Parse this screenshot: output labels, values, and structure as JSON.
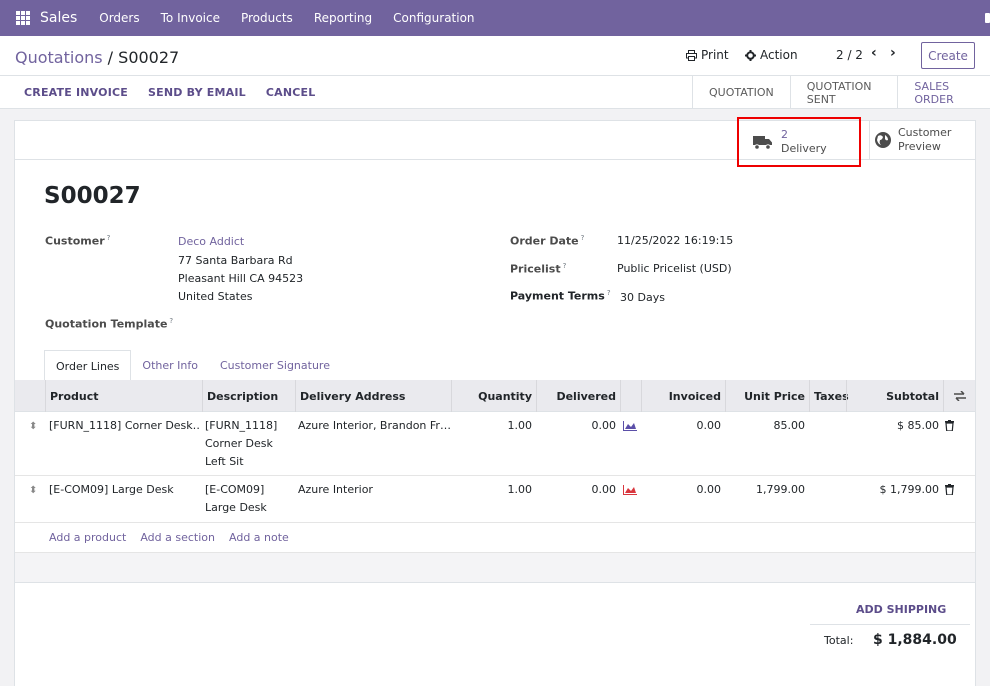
{
  "nav": {
    "brand": "Sales",
    "items": [
      "Orders",
      "To Invoice",
      "Products",
      "Reporting",
      "Configuration"
    ]
  },
  "control_panel": {
    "breadcrumb_parent": "Quotations",
    "breadcrumb_sep": " / ",
    "breadcrumb_current": "S00027",
    "print": "Print",
    "action": "Action",
    "pager": "2 / 2",
    "create": "Create"
  },
  "header": {
    "buttons": [
      "CREATE INVOICE",
      "SEND BY EMAIL",
      "CANCEL"
    ],
    "stages": [
      "QUOTATION",
      "QUOTATION SENT",
      "SALES ORDER"
    ],
    "active_stage": "SALES ORDER"
  },
  "smart_buttons": {
    "delivery_count": "2",
    "delivery_label": "Delivery",
    "preview_line1": "Customer",
    "preview_line2": "Preview"
  },
  "form": {
    "name": "S00027",
    "customer_label": "Customer",
    "customer_name": "Deco Addict",
    "address_line1": "77 Santa Barbara Rd",
    "address_line2": "Pleasant Hill CA 94523",
    "address_line3": "United States",
    "quotation_template_label": "Quotation Template",
    "order_date_label": "Order Date",
    "order_date": "11/25/2022 16:19:15",
    "pricelist_label": "Pricelist",
    "pricelist": "Public Pricelist (USD)",
    "payment_terms_label": "Payment Terms",
    "payment_terms": "30 Days",
    "help_mark": "?"
  },
  "tabs": [
    "Order Lines",
    "Other Info",
    "Customer Signature"
  ],
  "order_lines": {
    "columns": [
      "Product",
      "Description",
      "Delivery Address",
      "Quantity",
      "Delivered",
      "Invoiced",
      "Unit Price",
      "Taxes",
      "Subtotal"
    ],
    "rows": [
      {
        "product": "[FURN_1118] Corner Desk…",
        "description": [
          "[FURN_1118]",
          "Corner Desk",
          "Left Sit"
        ],
        "delivery_address": "Azure Interior, Brandon Fr…",
        "quantity": "1.00",
        "delivered": "0.00",
        "invoiced": "0.00",
        "unit_price": "85.00",
        "taxes": "",
        "subtotal": "$ 85.00",
        "forecast_color": "#5b4fa8"
      },
      {
        "product": "[E-COM09] Large Desk",
        "description": [
          "[E-COM09]",
          "Large Desk"
        ],
        "delivery_address": "Azure Interior",
        "quantity": "1.00",
        "delivered": "0.00",
        "invoiced": "0.00",
        "unit_price": "1,799.00",
        "taxes": "",
        "subtotal": "$ 1,799.00",
        "forecast_color": "#d9363e"
      }
    ],
    "add_product": "Add a product",
    "add_section": "Add a section",
    "add_note": "Add a note"
  },
  "totals": {
    "add_shipping": "ADD SHIPPING",
    "total_label": "Total:",
    "total_value": "$ 1,884.00"
  },
  "colors": {
    "brand": "#71639e",
    "highlight_box": "#ee0000"
  }
}
